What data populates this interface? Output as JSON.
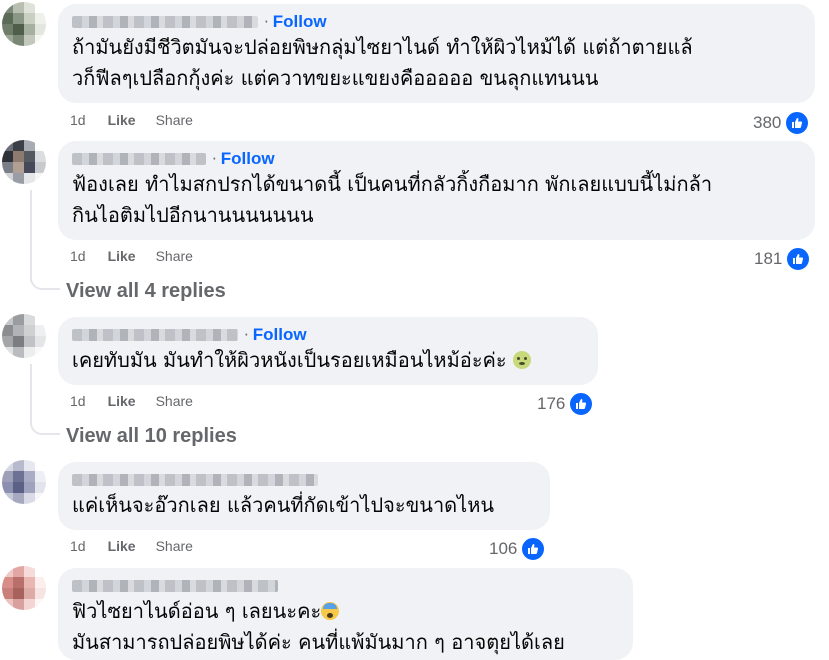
{
  "follow_label": "Follow",
  "separator": "·",
  "like_label": "Like",
  "share_label": "Share",
  "colors": {
    "accent": "#0866ff",
    "bubble": "#f0f2f5",
    "meta": "#65676b"
  },
  "comments": [
    {
      "lines": [
        "ถ้ามันยังมีชีวิตมันจะปล่อยพิษกลุ่มไซยาไนด์ ทำให้ผิวไหม้ได้ แต่ถ้าตายแล้",
        "วก็ฟีลๆเปลือกกุ้งค่ะ แต่ควาทขยะแขยงคือออออ ขนลุกแทนนน"
      ],
      "time": "1d",
      "reactions": "380"
    },
    {
      "lines": [
        "ฟ้องเลย ทำไมสกปรกได้ขนาดนี้ เป็นคนที่กลัวกิ้งกือมาก พักเลยแบบนี้ไม่กล้า",
        "กินไอติมไปอีกนานนนนนนน"
      ],
      "time": "1d",
      "reactions": "181",
      "replies_link": "View all 4 replies"
    },
    {
      "lines": [
        "เคยทับมัน มันทำให้ผิวหนังเป็นรอยเหมือนไหม้อ่ะค่ะ"
      ],
      "emoji": "nauseated-face",
      "time": "1d",
      "reactions": "176",
      "replies_link": "View all 10 replies"
    },
    {
      "lines": [
        "แค่เห็นจะอ๊วกเลย แล้วคนที่กัดเข้าไปจะขนาดไหน"
      ],
      "time": "1d",
      "reactions": "106"
    },
    {
      "lines": [
        "ฟิวไซยาไนด์อ่อน ๆ เลยนะคะ",
        "มันสามารถปล่อยพิษได้ค่ะ คนที่แพ้มันมาก ๆ อาจตุยได้เลย"
      ],
      "emoji": "anxious-face"
    }
  ]
}
